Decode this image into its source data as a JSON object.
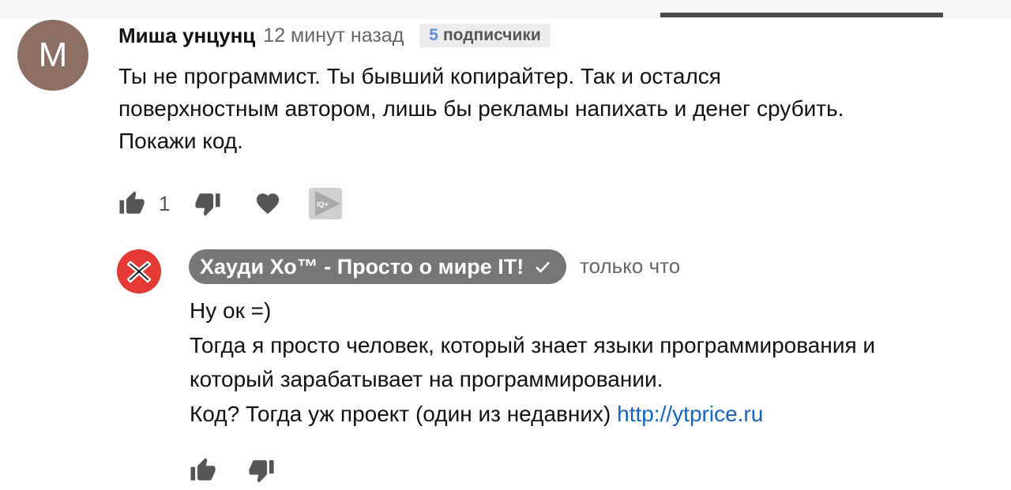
{
  "comment": {
    "avatar_letter": "M",
    "author": "Миша унцунц",
    "time": "12 минут назад",
    "subscribers": {
      "count": "5",
      "label": "подписчики"
    },
    "text_lines": [
      "Ты не программист. Ты бывший копирайтер. Так и остался",
      "поверхностным автором, лишь бы рекламы напихать и денег срубить.",
      "Покажи код."
    ],
    "likes": "1",
    "extension_label": "IQ+"
  },
  "reply": {
    "channel": "Хауди Хо™ - Просто о мире IT!",
    "time": "только что",
    "text_lines": [
      "Ну ок =)",
      "Тогда я просто человек, который знает языки программирования и",
      "который зарабатывает на программировании."
    ],
    "last_line_prefix": "Код? Тогда уж проект (один из недавних) ",
    "link": "http://ytprice.ru"
  },
  "colors": {
    "avatar_m": "#8d6e63",
    "avatar_x": "#e53935",
    "channel_pill": "#767676",
    "link": "#1565c0",
    "subs_count": "#5c8fd6"
  },
  "icons": [
    "thumb-up-icon",
    "thumb-down-icon",
    "heart-icon",
    "iq-plus-icon",
    "verified-check-icon",
    "channel-logo-icon"
  ]
}
